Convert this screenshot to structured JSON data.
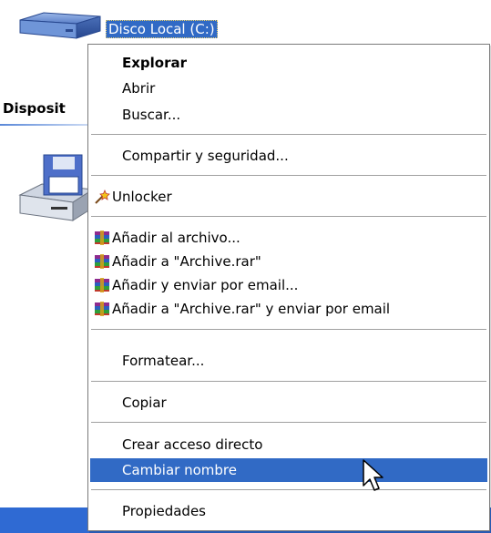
{
  "desktop": {
    "drive_label": "Disco Local (C:)",
    "section_title": "Disposit",
    "drive_icon": "hard-drive-icon",
    "floppy_icon": "floppy-drive-icon"
  },
  "context_menu": {
    "items": [
      {
        "label": "Explorar",
        "default": true
      },
      {
        "label": "Abrir"
      },
      {
        "label": "Buscar..."
      },
      {
        "label": "Compartir y seguridad..."
      },
      {
        "label": "Unlocker",
        "icon": "unlocker-wand-icon"
      },
      {
        "label": "Añadir al archivo...",
        "icon": "winrar-icon"
      },
      {
        "label": "Añadir a \"Archive.rar\"",
        "icon": "winrar-icon"
      },
      {
        "label": "Añadir y enviar por email...",
        "icon": "winrar-icon"
      },
      {
        "label": "Añadir a \"Archive.rar\" y enviar por email",
        "icon": "winrar-icon"
      },
      {
        "label": "Formatear..."
      },
      {
        "label": "Copiar"
      },
      {
        "label": "Crear acceso directo"
      },
      {
        "label": "Cambiar nombre",
        "highlighted": true
      },
      {
        "label": "Propiedades"
      }
    ]
  },
  "colors": {
    "selection": "#316ac5",
    "taskbar": "#2f6ad3"
  }
}
